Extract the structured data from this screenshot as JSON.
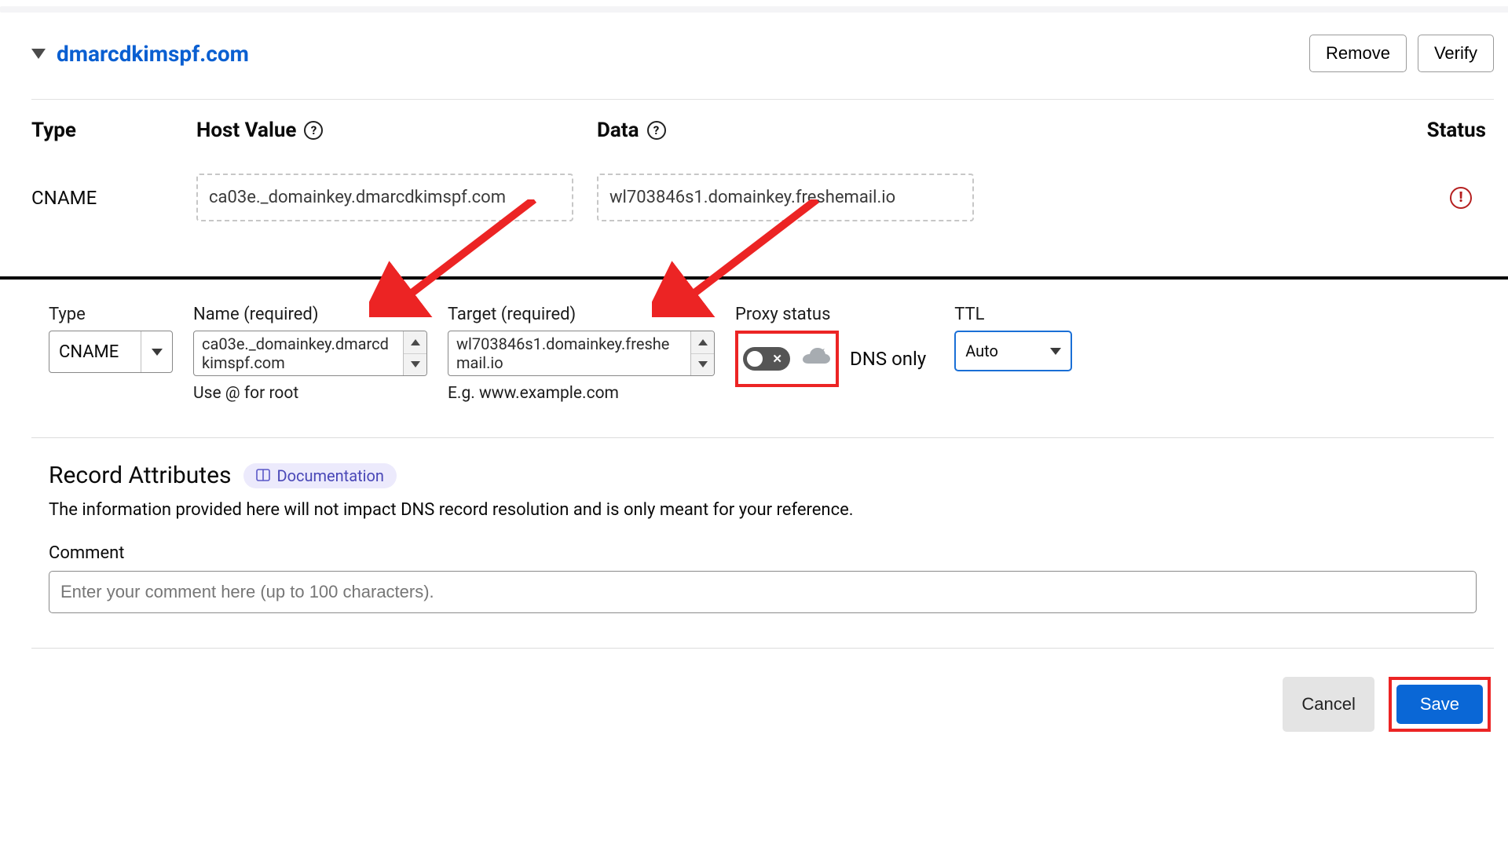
{
  "upper": {
    "domain": "dmarcdkimspf.com",
    "remove": "Remove",
    "verify": "Verify",
    "headers": {
      "type": "Type",
      "host": "Host Value",
      "data": "Data",
      "status": "Status"
    },
    "record": {
      "type": "CNAME",
      "host": "ca03e._domainkey.dmarcdkimspf.com",
      "data": "wl703846s1.domainkey.freshemail.io"
    }
  },
  "lower": {
    "type_label": "Type",
    "type_value": "CNAME",
    "name_label": "Name (required)",
    "name_value": "ca03e._domainkey.dmarcdkimspf.com",
    "name_hint": "Use @ for root",
    "target_label": "Target (required)",
    "target_value": "wl703846s1.domainkey.freshemail.io",
    "target_hint": "E.g. www.example.com",
    "proxy_label": "Proxy status",
    "proxy_text": "DNS only",
    "ttl_label": "TTL",
    "ttl_value": "Auto",
    "attrs_title": "Record Attributes",
    "doc_label": "Documentation",
    "attrs_desc": "The information provided here will not impact DNS record resolution and is only meant for your reference.",
    "comment_label": "Comment",
    "comment_placeholder": "Enter your comment here (up to 100 characters).",
    "cancel": "Cancel",
    "save": "Save"
  }
}
